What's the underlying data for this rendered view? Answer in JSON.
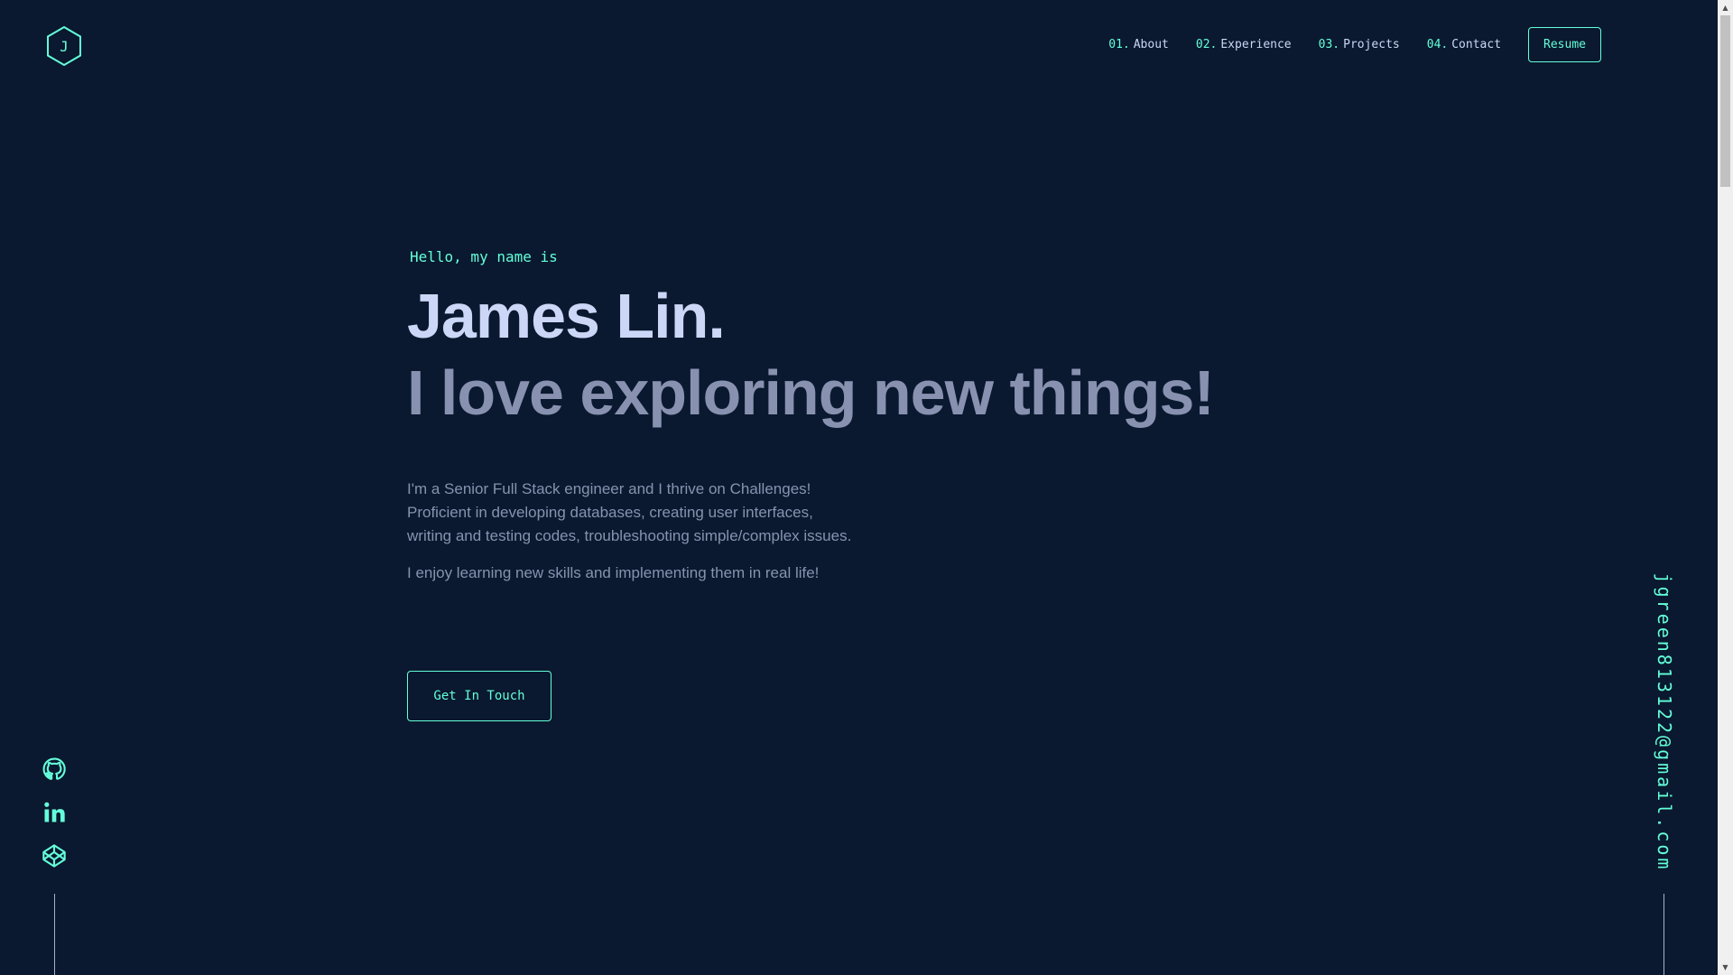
{
  "header": {
    "logo_letter": "J",
    "nav": [
      {
        "num": "01.",
        "label": "About"
      },
      {
        "num": "02.",
        "label": "Experience"
      },
      {
        "num": "03.",
        "label": "Projects"
      },
      {
        "num": "04.",
        "label": "Contact"
      }
    ],
    "resume_label": "Resume"
  },
  "hero": {
    "greeting": "Hello, my name is",
    "name": "James Lin.",
    "tagline": "I love exploring new things!",
    "bio": [
      "I'm a Senior Full Stack engineer and I thrive on Challenges! Proficient in developing databases, creating user interfaces, writing and testing codes, troubleshooting simple/complex issues.",
      "I enjoy learning new skills and implementing them in real life!"
    ],
    "cta_label": "Get In Touch"
  },
  "social": [
    {
      "icon": "github-icon"
    },
    {
      "icon": "linkedin-icon"
    },
    {
      "icon": "codepen-icon"
    }
  ],
  "email": "jgreen813122@gmail.com",
  "colors": {
    "background": "#0a192f",
    "accent": "#64ffda",
    "heading": "#ccd6f6",
    "body_text": "#8892b0"
  }
}
